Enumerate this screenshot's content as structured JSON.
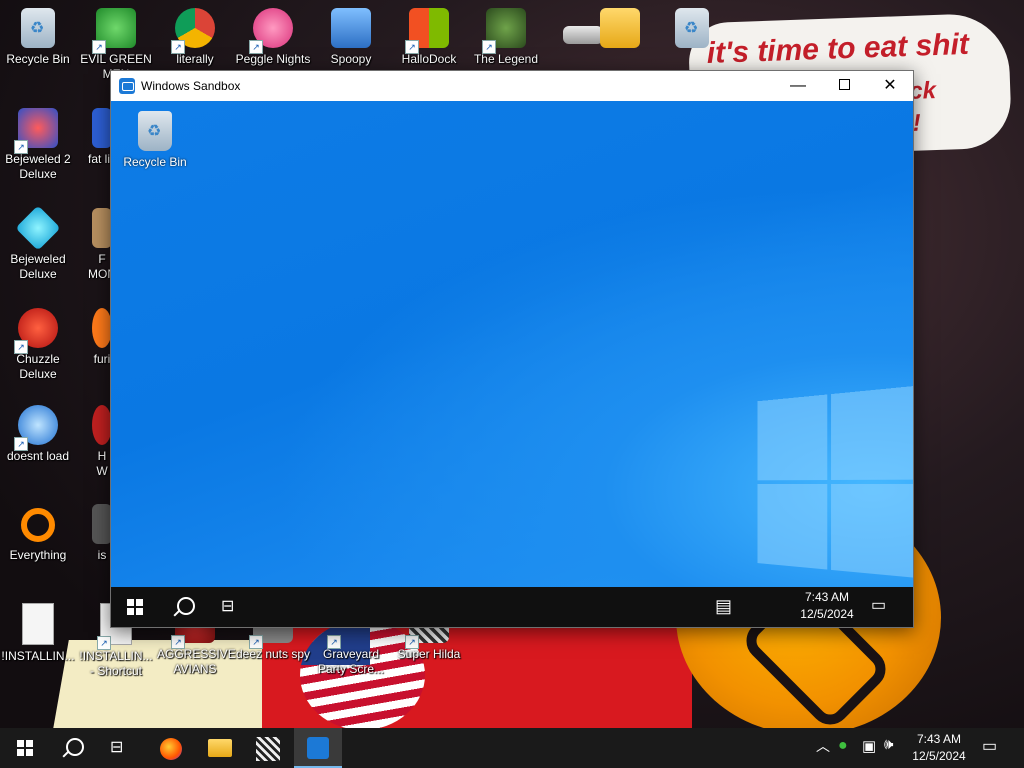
{
  "wallpaper": {
    "note_line1": "it's time to eat shit",
    "note_line2": "trick",
    "note_line3": "te!"
  },
  "desktop": {
    "icons": [
      {
        "label": "Recycle Bin"
      },
      {
        "label": "EVIL GREEN\nMEN"
      },
      {
        "label": "literally"
      },
      {
        "label": "Peggle Nights"
      },
      {
        "label": "Spoopy"
      },
      {
        "label": "HalloDock"
      },
      {
        "label": "The Legend"
      },
      {
        "label": "Bejeweled 2\nDeluxe"
      },
      {
        "label": "fat lik"
      },
      {
        "label": "Bejeweled\nDeluxe"
      },
      {
        "label": "F\nMON"
      },
      {
        "label": "Chuzzle\nDeluxe"
      },
      {
        "label": "furi"
      },
      {
        "label": "doesnt load"
      },
      {
        "label": "H\nW"
      },
      {
        "label": "Everything"
      },
      {
        "label": "is"
      },
      {
        "label": "!INSTALLIN..."
      },
      {
        "label": "!INSTALLIN...\n- Shortcut"
      },
      {
        "label": "AGGRESSIVE\nAVIANS"
      },
      {
        "label": "deez nuts spy"
      },
      {
        "label": "Graveyard\nParty Scre..."
      },
      {
        "label": "Super Hilda"
      }
    ]
  },
  "sandbox": {
    "title": "Windows Sandbox",
    "minimize": "—",
    "close": "✕",
    "inner_recycle_bin": "Recycle Bin",
    "time": "7:43 AM",
    "date": "12/5/2024"
  },
  "taskbar": {
    "time": "7:43 AM",
    "date": "12/5/2024"
  },
  "colors": {
    "accent": "#76b9ed",
    "sandbox_blue": "#0a78e3"
  }
}
